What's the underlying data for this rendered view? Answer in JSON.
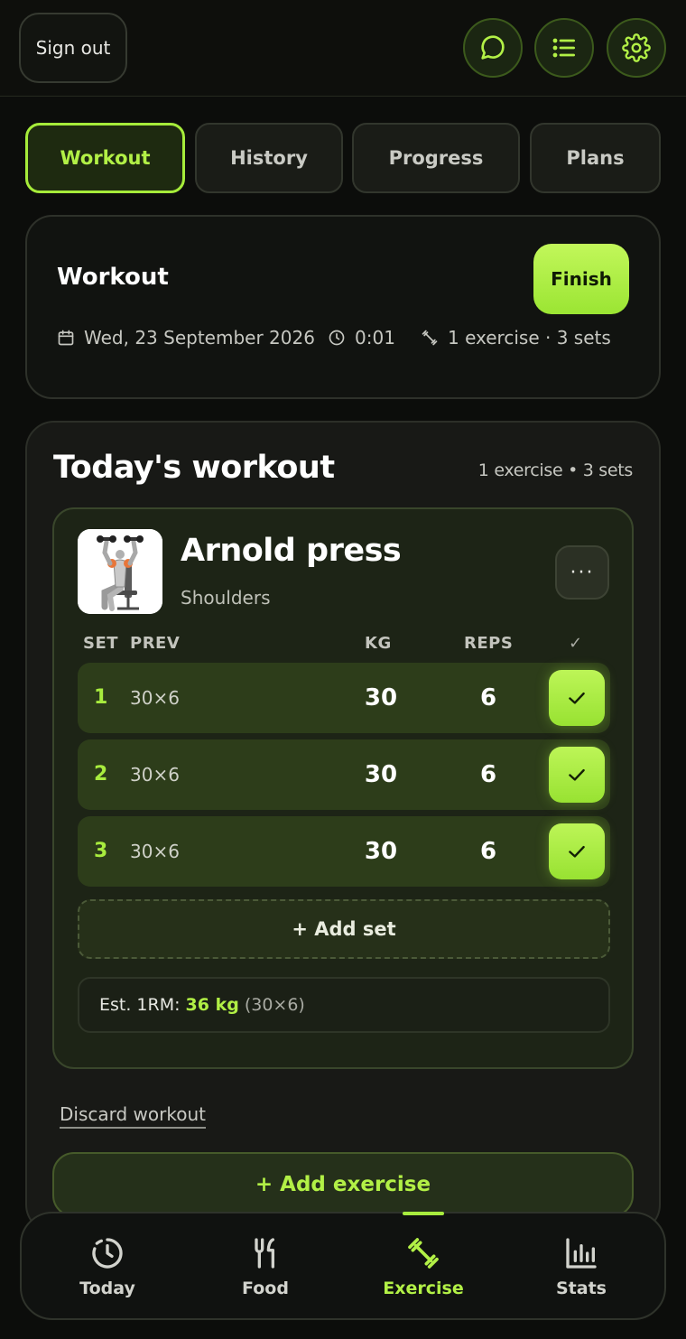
{
  "topbar": {
    "sign_out_label": "Sign out",
    "buttons": [
      {
        "icon": "chat-bubble-icon"
      },
      {
        "icon": "list-icon"
      },
      {
        "icon": "gear-icon"
      }
    ]
  },
  "tabs": [
    {
      "label": "Workout",
      "active": true
    },
    {
      "label": "History",
      "active": false
    },
    {
      "label": "Progress",
      "active": false
    },
    {
      "label": "Plans",
      "active": false
    }
  ],
  "workout_header": {
    "title": "Workout",
    "finish_label": "Finish",
    "date": "Wed, 23 September 2026",
    "duration": "0:01",
    "summary": "1 exercise · 3 sets"
  },
  "today": {
    "title": "Today's workout",
    "summary": "1 exercise • 3 sets",
    "exercise": {
      "name": "Arnold press",
      "muscle": "Shoulders",
      "more_label": "···",
      "columns": {
        "set": "SET",
        "prev": "PREV",
        "kg": "KG",
        "reps": "REPS",
        "done": "✓"
      },
      "sets": [
        {
          "num": "1",
          "prev": "30×6",
          "kg": "30",
          "reps": "6",
          "done": true
        },
        {
          "num": "2",
          "prev": "30×6",
          "kg": "30",
          "reps": "6",
          "done": true
        },
        {
          "num": "3",
          "prev": "30×6",
          "kg": "30",
          "reps": "6",
          "done": true
        }
      ],
      "add_set_label": "+ Add set",
      "est_1rm": {
        "label": "Est. 1RM:",
        "value": "36 kg",
        "note": "(30×6)"
      }
    },
    "discard_label": "Discard workout",
    "add_exercise_label": "+ Add exercise"
  },
  "bottom_nav": [
    {
      "label": "Today",
      "icon": "clock-history-icon",
      "active": false
    },
    {
      "label": "Food",
      "icon": "fork-knife-icon",
      "active": false
    },
    {
      "label": "Exercise",
      "icon": "dumbbell-icon",
      "active": true
    },
    {
      "label": "Stats",
      "icon": "bar-chart-icon",
      "active": false
    }
  ],
  "colors": {
    "accent": "#a8ec3e",
    "background": "#0c0d0b",
    "card": "#181916",
    "set_row": "#2d3d1a"
  }
}
